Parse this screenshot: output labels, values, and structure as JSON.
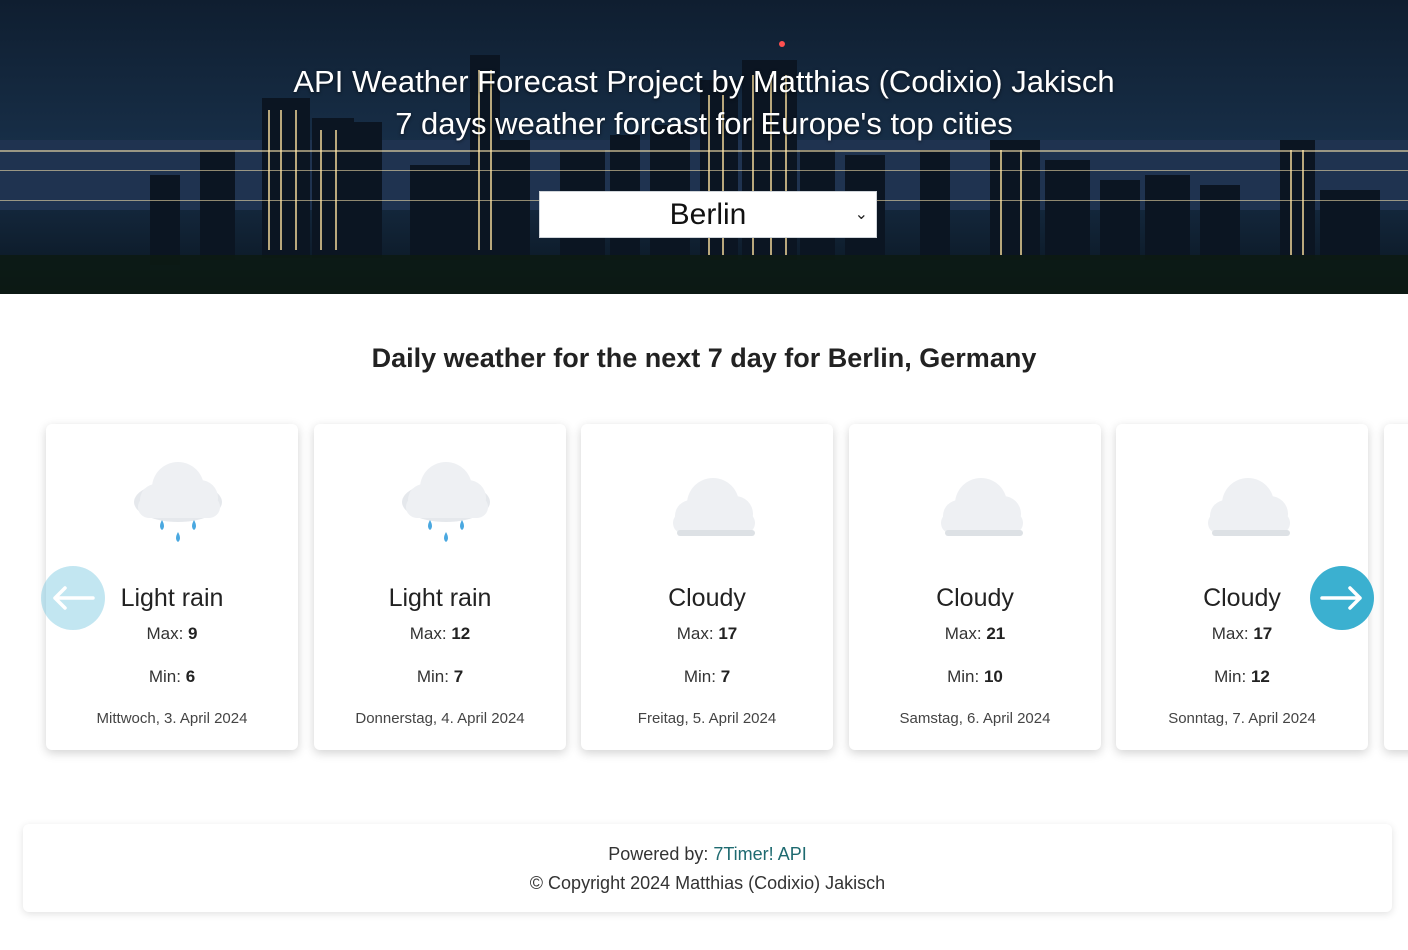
{
  "header": {
    "title": "API Weather Forecast Project by Matthias (Codixio) Jakisch",
    "subtitle": "7 days weather forcast for Europe's top cities",
    "city_select": {
      "selected": "Berlin"
    }
  },
  "section_title": "Daily weather for the next 7 day for Berlin, Germany",
  "carousel": {
    "max_label": "Max:",
    "min_label": "Min:",
    "cards": [
      {
        "icon": "rain-cloud-icon",
        "condition": "Light rain",
        "max": "9",
        "min": "6",
        "date": "Mittwoch, 3. April 2024"
      },
      {
        "icon": "rain-cloud-icon",
        "condition": "Light rain",
        "max": "12",
        "min": "7",
        "date": "Donnerstag, 4. April 2024"
      },
      {
        "icon": "cloud-icon",
        "condition": "Cloudy",
        "max": "17",
        "min": "7",
        "date": "Freitag, 5. April 2024"
      },
      {
        "icon": "cloud-icon",
        "condition": "Cloudy",
        "max": "21",
        "min": "10",
        "date": "Samstag, 6. April 2024"
      },
      {
        "icon": "cloud-icon",
        "condition": "Cloudy",
        "max": "17",
        "min": "12",
        "date": "Sonntag, 7. April 2024"
      }
    ],
    "prev_icon": "arrow-left-icon",
    "next_icon": "arrow-right-icon"
  },
  "footer": {
    "powered_by": "Powered by: ",
    "api_link": "7Timer! API",
    "copyright": "© Copyright 2024 Matthias (Codixio) Jakisch"
  },
  "colors": {
    "accent": "#3bb0d0",
    "rain_drop": "#4aa8e0",
    "cloud": "#eef0f3"
  }
}
